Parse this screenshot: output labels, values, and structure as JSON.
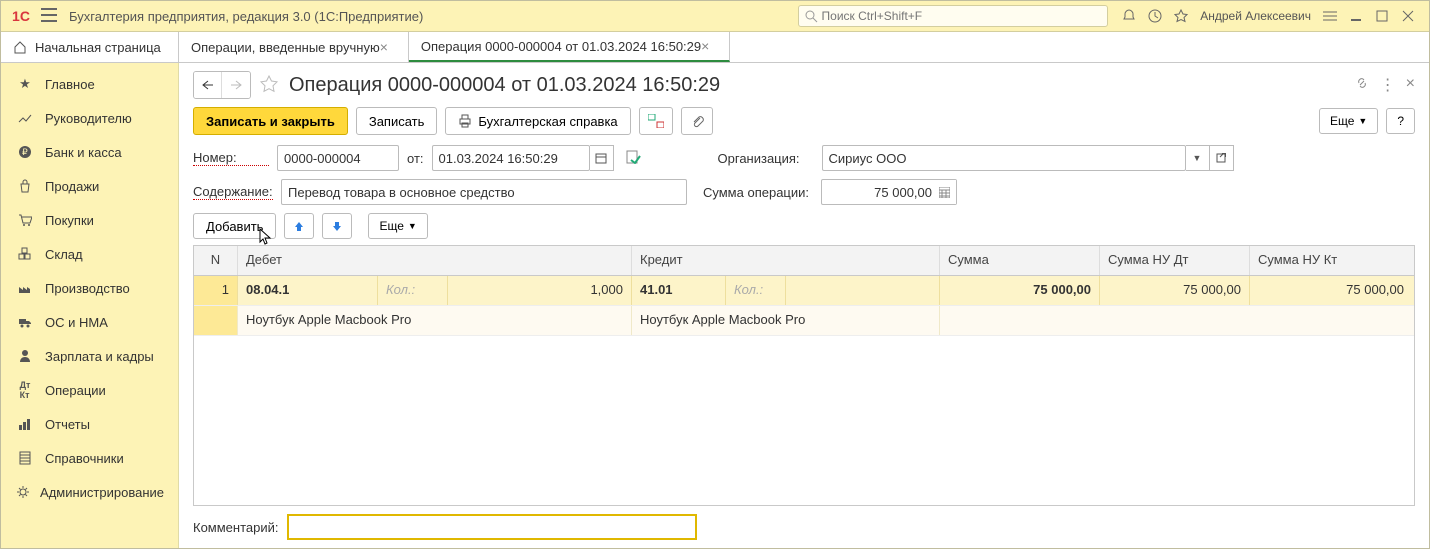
{
  "app": {
    "title": "Бухгалтерия предприятия, редакция 3.0  (1С:Предприятие)",
    "search_placeholder": "Поиск Ctrl+Shift+F",
    "user": "Андрей Алексеевич"
  },
  "tabs": {
    "home": "Начальная страница",
    "t1": "Операции, введенные вручную",
    "t2": "Операция 0000-000004 от 01.03.2024 16:50:29"
  },
  "sidebar": [
    "Главное",
    "Руководителю",
    "Банк и касса",
    "Продажи",
    "Покупки",
    "Склад",
    "Производство",
    "ОС и НМА",
    "Зарплата и кадры",
    "Операции",
    "Отчеты",
    "Справочники",
    "Администрирование"
  ],
  "page": {
    "title": "Операция 0000-000004 от 01.03.2024 16:50:29",
    "btn_save_close": "Записать и закрыть",
    "btn_save": "Записать",
    "btn_print": "Бухгалтерская справка",
    "more": "Еще",
    "help": "?"
  },
  "form": {
    "number_label": "Номер:",
    "number": "0000-000004",
    "from_label": "от:",
    "date": "01.03.2024 16:50:29",
    "org_label": "Организация:",
    "org": "Сириус ООО",
    "content_label": "Содержание:",
    "content": "Перевод товара в основное средство",
    "sum_label": "Сумма операции:",
    "sum": "75 000,00",
    "add_btn": "Добавить",
    "comment_label": "Комментарий:"
  },
  "table": {
    "h_n": "N",
    "h_debit": "Дебет",
    "h_credit": "Кредит",
    "h_sum": "Сумма",
    "h_sum_dt": "Сумма НУ Дт",
    "h_sum_kt": "Сумма НУ Кт",
    "row": {
      "n": "1",
      "debit_acc": "08.04.1",
      "qty_label": "Кол.:",
      "debit_qty": "1,000",
      "credit_acc": "41.01",
      "sum": "75 000,00",
      "sum_dt": "75 000,00",
      "sum_kt": "75 000,00",
      "debit_desc": "Ноутбук Apple Macbook Pro",
      "credit_desc": "Ноутбук Apple Macbook Pro"
    }
  }
}
